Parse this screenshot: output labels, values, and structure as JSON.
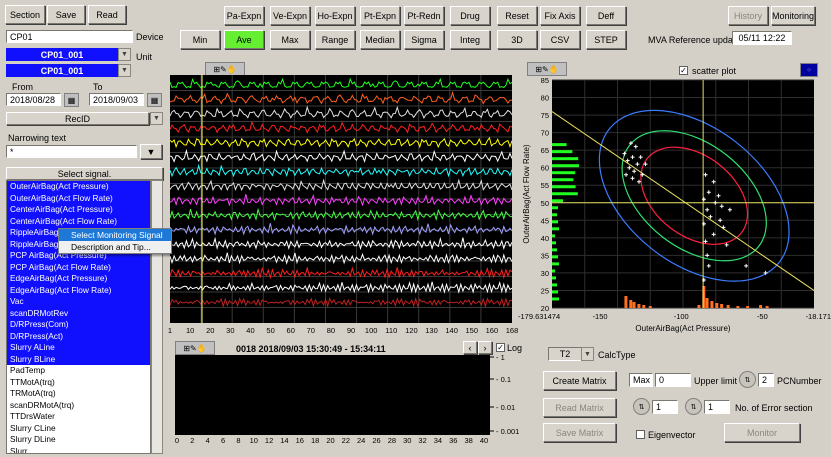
{
  "toolbar_left": {
    "section": "Section",
    "save": "Save",
    "read": "Read"
  },
  "toolbar_row1": [
    "Pa-Expn",
    "Ve-Expn",
    "Ho-Expn",
    "Pt-Expn",
    "Pt-Redn",
    "Drug",
    "Reset",
    "Fix Axis",
    "Deff"
  ],
  "toolbar_row2": [
    "Min",
    "Ave",
    "Max",
    "Range",
    "Median",
    "Sigma",
    "Integ",
    "3D",
    "CSV",
    "STEP"
  ],
  "active_stat": "Ave",
  "right_buttons": {
    "history": "History",
    "monitoring": "Monitoring"
  },
  "mva": {
    "label": "MVA Reference update",
    "value": "05/11 12:22"
  },
  "device": {
    "label": "Device",
    "value": "CP01"
  },
  "unit": {
    "label": "Unit",
    "values": [
      "CP01_001",
      "CP01_001"
    ]
  },
  "period": {
    "from_label": "From",
    "to_label": "To",
    "from": "2018/08/28",
    "to": "2018/09/03"
  },
  "recid": "RecID",
  "narrowing": {
    "label": "Narrowing text",
    "value": "*"
  },
  "signal_header": "Select signal.",
  "signals": [
    {
      "name": "OuterAirBag(Act Pressure)",
      "selected": true
    },
    {
      "name": "OuterAirBag(Act Flow Rate)",
      "selected": true
    },
    {
      "name": "CenterAirBag(Act Pressure)",
      "selected": true
    },
    {
      "name": "CenterAirBag(Act Flow Rate)",
      "selected": true
    },
    {
      "name": "RippleAirBag(Act Pressure)",
      "selected": true
    },
    {
      "name": "RippleAirBag(Act Flow Rate)",
      "selected": true
    },
    {
      "name": "PCP AirBag(Act Pressure)",
      "selected": true
    },
    {
      "name": "PCP AirBag(Act Flow Rate)",
      "selected": true
    },
    {
      "name": "EdgeAirBag(Act Pressure)",
      "selected": true
    },
    {
      "name": "EdgeAirBag(Act Flow Rate)",
      "selected": true
    },
    {
      "name": "Vac",
      "selected": true
    },
    {
      "name": "scanDRMotRev",
      "selected": true
    },
    {
      "name": "D/RPress(Com)",
      "selected": true
    },
    {
      "name": "D/RPress(Act)",
      "selected": true
    },
    {
      "name": "Slurry ALine",
      "selected": true
    },
    {
      "name": "Slurry BLine",
      "selected": true
    },
    {
      "name": "PadTemp",
      "selected": false
    },
    {
      "name": "TTMotA(trq)",
      "selected": false
    },
    {
      "name": "TRMotA(trq)",
      "selected": false
    },
    {
      "name": "scanDRMotA(trq)",
      "selected": false
    },
    {
      "name": "TTDrsWater",
      "selected": false
    },
    {
      "name": "Slurry CLine",
      "selected": false
    },
    {
      "name": "Slurry DLine",
      "selected": false
    },
    {
      "name": "Slurr...",
      "selected": false
    }
  ],
  "context_menu": [
    "Select Monitoring Signal",
    "Description and Tip..."
  ],
  "trend": {
    "x_ticks": [
      "1",
      "10",
      "20",
      "30",
      "40",
      "50",
      "60",
      "70",
      "80",
      "90",
      "100",
      "110",
      "120",
      "130",
      "140",
      "150",
      "160",
      "168"
    ],
    "colors": [
      "#20ff20",
      "#ff6020",
      "#e0e0e0",
      "#ff2020",
      "#ffff00",
      "#ffffff",
      "#20ffff",
      "#e0e0e0",
      "#ff40ff",
      "#40ff40",
      "#a0a0ff",
      "#ffffff",
      "#ffffff",
      "#ff2020",
      "#ffffff",
      "#c02020"
    ]
  },
  "wave": {
    "header": "0018 2018/09/03 15:30:49 - 15:34:11",
    "log_label": "Log",
    "y_ticks": [
      "1",
      "0.1",
      "0.01",
      "0.001"
    ],
    "x_ticks": [
      "0",
      "2",
      "4",
      "6",
      "8",
      "10",
      "12",
      "14",
      "16",
      "18",
      "20",
      "22",
      "24",
      "26",
      "28",
      "30",
      "32",
      "34",
      "36",
      "38",
      "40"
    ]
  },
  "scatter_label": "scatter plot",
  "chart_data": {
    "type": "scatter",
    "title": "scatter plot",
    "xlabel": "OuterAirBag(Act Pressure)",
    "ylabel": "OuterAirBag(Act Flow Rate)",
    "xlim": [
      -179.631474,
      -18.171
    ],
    "ylim": [
      20,
      85
    ],
    "x_tick_labels": [
      "-179.631474",
      "-150",
      "-100",
      "-50",
      "-18.171"
    ],
    "y_ticks": [
      20,
      25,
      30,
      35,
      40,
      45,
      50,
      55,
      60,
      65,
      70,
      75,
      80,
      85
    ],
    "points": [
      [
        -131,
        67
      ],
      [
        -128,
        66
      ],
      [
        -135,
        64
      ],
      [
        -130,
        63
      ],
      [
        -125,
        63
      ],
      [
        -133,
        62
      ],
      [
        -127,
        61
      ],
      [
        -122,
        61
      ],
      [
        -132,
        60
      ],
      [
        -129,
        59
      ],
      [
        -124,
        58
      ],
      [
        -134,
        58
      ],
      [
        -130,
        57
      ],
      [
        -126,
        56
      ],
      [
        -85,
        58
      ],
      [
        -80,
        56
      ],
      [
        -83,
        53
      ],
      [
        -77,
        52
      ],
      [
        -86,
        51
      ],
      [
        -79,
        50
      ],
      [
        -75,
        49
      ],
      [
        -84,
        48
      ],
      [
        -70,
        48
      ],
      [
        -82,
        46
      ],
      [
        -76,
        45
      ],
      [
        -86,
        44
      ],
      [
        -74,
        43
      ],
      [
        -80,
        41
      ],
      [
        -85,
        39
      ],
      [
        -72,
        38
      ],
      [
        -84,
        35
      ],
      [
        -83,
        32
      ],
      [
        -60,
        32
      ],
      [
        -48,
        30
      ],
      [
        -86,
        28
      ]
    ],
    "cursor": {
      "x": -86.5,
      "y": 50
    }
  },
  "calc": {
    "type_value": "T2",
    "type_label": "CalcType",
    "create_matrix": "Create Matrix",
    "max_label": "Max",
    "max_value": "0",
    "upper_limit_label": "Upper limit",
    "pc_value": "2",
    "pc_label": "PCNumber",
    "read_matrix": "Read Matrix",
    "save_matrix": "Save Matrix",
    "err1": "1",
    "err2": "1",
    "err_label": "No. of Error section",
    "eigen_label": "Eigenvector",
    "monitor": "Monitor"
  }
}
